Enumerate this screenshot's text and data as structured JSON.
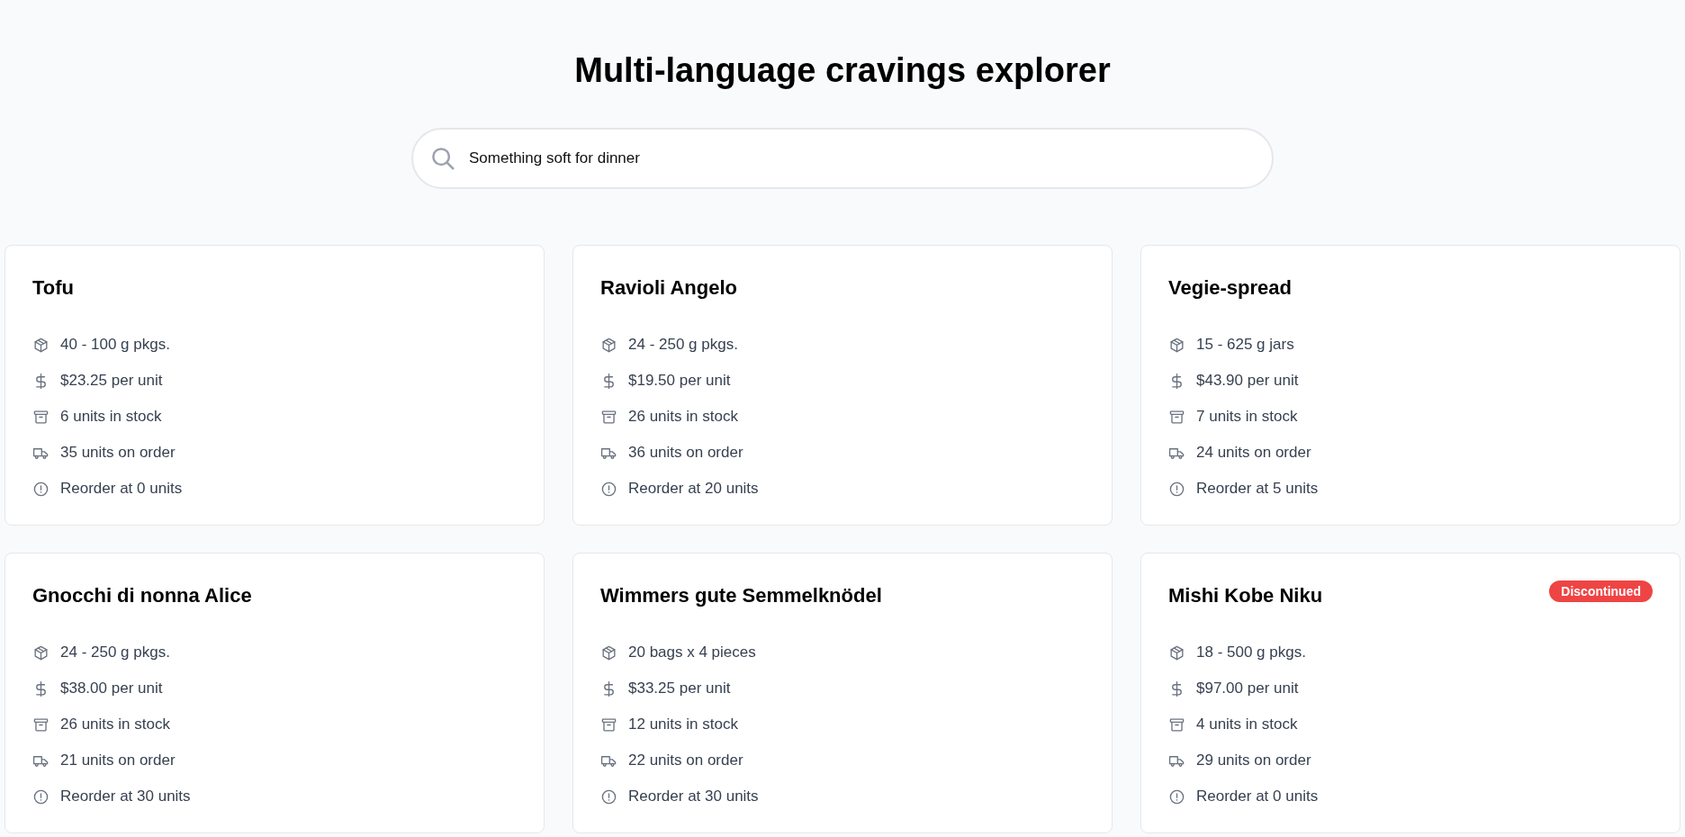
{
  "title": "Multi-language cravings explorer",
  "search": {
    "value": "Something soft for dinner"
  },
  "products": [
    {
      "name": "Tofu",
      "discontinued": false,
      "details": [
        {
          "kind": "package",
          "text": "40 - 100 g pkgs."
        },
        {
          "kind": "price",
          "text": "$23.25 per unit"
        },
        {
          "kind": "stock",
          "text": "6 units in stock"
        },
        {
          "kind": "order",
          "text": "35 units on order"
        },
        {
          "kind": "reorder",
          "text": "Reorder at 0 units"
        }
      ]
    },
    {
      "name": "Ravioli Angelo",
      "discontinued": false,
      "details": [
        {
          "kind": "package",
          "text": "24 - 250 g pkgs."
        },
        {
          "kind": "price",
          "text": "$19.50 per unit"
        },
        {
          "kind": "stock",
          "text": "26 units in stock"
        },
        {
          "kind": "order",
          "text": "36 units on order"
        },
        {
          "kind": "reorder",
          "text": "Reorder at 20 units"
        }
      ]
    },
    {
      "name": "Vegie-spread",
      "discontinued": false,
      "details": [
        {
          "kind": "package",
          "text": "15 - 625 g jars"
        },
        {
          "kind": "price",
          "text": "$43.90 per unit"
        },
        {
          "kind": "stock",
          "text": "7 units in stock"
        },
        {
          "kind": "order",
          "text": "24 units on order"
        },
        {
          "kind": "reorder",
          "text": "Reorder at 5 units"
        }
      ]
    },
    {
      "name": "Gnocchi di nonna Alice",
      "discontinued": false,
      "details": [
        {
          "kind": "package",
          "text": "24 - 250 g pkgs."
        },
        {
          "kind": "price",
          "text": "$38.00 per unit"
        },
        {
          "kind": "stock",
          "text": "26 units in stock"
        },
        {
          "kind": "order",
          "text": "21 units on order"
        },
        {
          "kind": "reorder",
          "text": "Reorder at 30 units"
        }
      ]
    },
    {
      "name": "Wimmers gute Semmelknödel",
      "discontinued": false,
      "details": [
        {
          "kind": "package",
          "text": "20 bags x 4 pieces"
        },
        {
          "kind": "price",
          "text": "$33.25 per unit"
        },
        {
          "kind": "stock",
          "text": "12 units in stock"
        },
        {
          "kind": "order",
          "text": "22 units on order"
        },
        {
          "kind": "reorder",
          "text": "Reorder at 30 units"
        }
      ]
    },
    {
      "name": "Mishi Kobe Niku",
      "discontinued": true,
      "badge": "Discontinued",
      "details": [
        {
          "kind": "package",
          "text": "18 - 500 g pkgs."
        },
        {
          "kind": "price",
          "text": "$97.00 per unit"
        },
        {
          "kind": "stock",
          "text": "4 units in stock"
        },
        {
          "kind": "order",
          "text": "29 units on order"
        },
        {
          "kind": "reorder",
          "text": "Reorder at 0 units"
        }
      ]
    }
  ]
}
